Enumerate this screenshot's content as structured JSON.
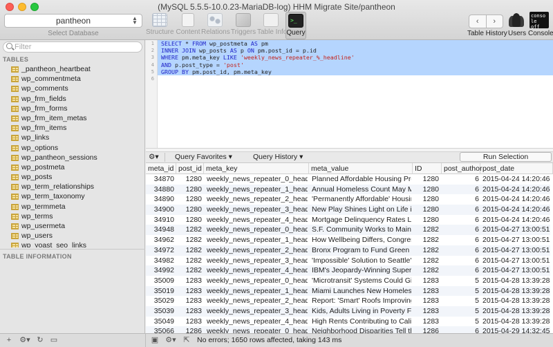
{
  "window": {
    "title": "(MySQL 5.5.5-10.0.23-MariaDB-log) HHM Migrate Site/pantheon"
  },
  "database_selector": {
    "value": "pantheon",
    "label": "Select Database"
  },
  "toolbar": {
    "tools": [
      "Structure",
      "Content",
      "Relations",
      "Triggers",
      "Table Info",
      "Query"
    ],
    "active_tool": "Query",
    "table_history_label": "Table History",
    "users_label": "Users",
    "console_label": "Console",
    "console_icon_text": "conso le off"
  },
  "sidebar": {
    "filter_placeholder": "Filter",
    "tables_heading": "TABLES",
    "tables": [
      "_pantheon_heartbeat",
      "wp_commentmeta",
      "wp_comments",
      "wp_frm_fields",
      "wp_frm_forms",
      "wp_frm_item_metas",
      "wp_frm_items",
      "wp_links",
      "wp_options",
      "wp_pantheon_sessions",
      "wp_postmeta",
      "wp_posts",
      "wp_term_relationships",
      "wp_term_taxonomy",
      "wp_termmeta",
      "wp_terms",
      "wp_usermeta",
      "wp_users",
      "wp_yoast_seo_links"
    ],
    "table_info_heading": "TABLE INFORMATION"
  },
  "editor": {
    "line_numbers": [
      "1",
      "2",
      "3",
      "4",
      "5",
      "6"
    ],
    "lines": [
      [
        {
          "t": "SELECT",
          "k": "kw"
        },
        {
          "t": " * "
        },
        {
          "t": "FROM",
          "k": "kw"
        },
        {
          "t": " wp_postmeta "
        },
        {
          "t": "AS",
          "k": "kw"
        },
        {
          "t": " pm"
        }
      ],
      [
        {
          "t": "INNER JOIN",
          "k": "kw"
        },
        {
          "t": " wp_posts "
        },
        {
          "t": "AS",
          "k": "kw"
        },
        {
          "t": " p "
        },
        {
          "t": "ON",
          "k": "kw"
        },
        {
          "t": " pm.post_id = p.id"
        }
      ],
      [
        {
          "t": "WHERE",
          "k": "kw"
        },
        {
          "t": " pm.meta_key "
        },
        {
          "t": "LIKE",
          "k": "kw"
        },
        {
          "t": " "
        },
        {
          "t": "'weekly_news_repeater_%_headline'",
          "k": "str"
        }
      ],
      [
        {
          "t": "AND",
          "k": "kw"
        },
        {
          "t": " p.post_type = "
        },
        {
          "t": "'post'",
          "k": "str"
        }
      ],
      [
        {
          "t": "GROUP BY",
          "k": "kw"
        },
        {
          "t": " pm.post_id, pm.meta_key"
        }
      ],
      []
    ]
  },
  "query_bar": {
    "favorites_label": "Query Favorites",
    "history_label": "Query History",
    "run_label": "Run Selection"
  },
  "results": {
    "columns": [
      "meta_id",
      "post_id",
      "meta_key",
      "meta_value",
      "ID",
      "post_author",
      "post_date"
    ],
    "rows": [
      [
        "34870",
        "1280",
        "weekly_news_repeater_0_headline",
        "Planned Affordable Housing Projec...",
        "1280",
        "6",
        "2015-04-24 14:20:46"
      ],
      [
        "34880",
        "1280",
        "weekly_news_repeater_1_headline",
        "Annual Homeless Count May Miss...",
        "1280",
        "6",
        "2015-04-24 14:20:46"
      ],
      [
        "34890",
        "1280",
        "weekly_news_repeater_2_headline",
        "'Permanently Affordable' Housing...",
        "1280",
        "6",
        "2015-04-24 14:20:46"
      ],
      [
        "34900",
        "1280",
        "weekly_news_repeater_3_headline",
        "New Play Shines Light on Life in C...",
        "1280",
        "6",
        "2015-04-24 14:20:46"
      ],
      [
        "34910",
        "1280",
        "weekly_news_repeater_4_headline",
        "Mortgage Delinquency Rates Lowe...",
        "1280",
        "6",
        "2015-04-24 14:20:46"
      ],
      [
        "34948",
        "1282",
        "weekly_news_repeater_0_headline",
        "S.F. Community Works to Maintain...",
        "1282",
        "6",
        "2015-04-27 13:00:51"
      ],
      [
        "34962",
        "1282",
        "weekly_news_repeater_1_headline",
        "How Wellbeing Differs, Congressio...",
        "1282",
        "6",
        "2015-04-27 13:00:51"
      ],
      [
        "34972",
        "1282",
        "weekly_news_repeater_2_headline",
        "Bronx Program to Fund Green Ene...",
        "1282",
        "6",
        "2015-04-27 13:00:51"
      ],
      [
        "34982",
        "1282",
        "weekly_news_repeater_3_headline",
        "'Impossible' Solution to Seattle's...",
        "1282",
        "6",
        "2015-04-27 13:00:51"
      ],
      [
        "34992",
        "1282",
        "weekly_news_repeater_4_headline",
        "IBM's Jeopardy-Winning Supercom...",
        "1282",
        "6",
        "2015-04-27 13:00:51"
      ],
      [
        "35009",
        "1283",
        "weekly_news_repeater_0_headline",
        "'Microtransit' Systems Could Give...",
        "1283",
        "5",
        "2015-04-28 13:39:28"
      ],
      [
        "35019",
        "1283",
        "weekly_news_repeater_1_headline",
        "Miami Launches New Homeless Ini...",
        "1283",
        "5",
        "2015-04-28 13:39:28"
      ],
      [
        "35029",
        "1283",
        "weekly_news_repeater_2_headline",
        "Report: 'Smart' Roofs Improving Li...",
        "1283",
        "5",
        "2015-04-28 13:39:28"
      ],
      [
        "35039",
        "1283",
        "weekly_news_repeater_3_headline",
        "Kids, Adults Living in Poverty Face...",
        "1283",
        "5",
        "2015-04-28 13:39:28"
      ],
      [
        "35049",
        "1283",
        "weekly_news_repeater_4_headline",
        "High Rents Contributing to Califor...",
        "1283",
        "5",
        "2015-04-28 13:39:28"
      ],
      [
        "35066",
        "1286",
        "weekly_news_repeater_0_headline",
        "Neighborhood Disparities Tell the...",
        "1286",
        "6",
        "2015-04-29 14:32:45"
      ]
    ]
  },
  "status": {
    "message": "No errors; 1650 rows affected, taking 143 ms"
  }
}
